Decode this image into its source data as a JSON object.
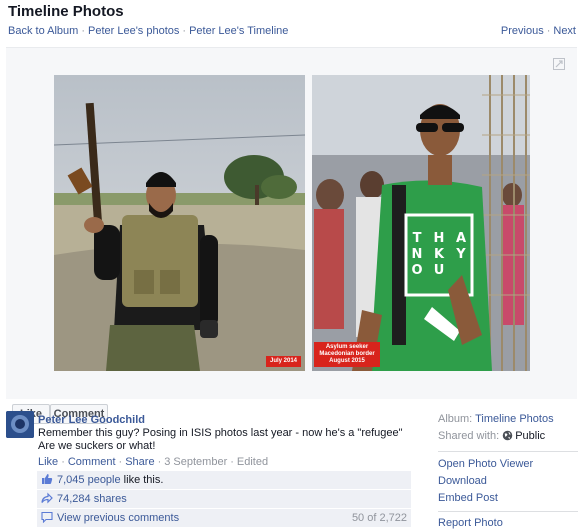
{
  "header": {
    "title": "Timeline Photos",
    "back_to_album": "Back to Album",
    "sep": "·",
    "photos_link": "Peter Lee's photos",
    "timeline_link": "Peter Lee's Timeline",
    "previous": "Previous",
    "next": "Next"
  },
  "photo": {
    "left_caption": "July 2014",
    "right_caption_line1": "Asylum seeker",
    "right_caption_line2": "Macedonian border",
    "right_caption_line3": "August 2015",
    "shirt_text": [
      "T",
      "H",
      "A",
      "N",
      "K",
      "Y",
      "O",
      "U"
    ]
  },
  "actions": {
    "like": "Like",
    "comment": "Comment"
  },
  "post": {
    "author": "Peter Lee Goodchild",
    "line1": "Remember this guy? Posing in ISIS photos last year - now he's a \"refugee\"",
    "line2": "Are we suckers or what!",
    "meta_like": "Like",
    "meta_comment": "Comment",
    "meta_share": "Share",
    "meta_date": "3 September",
    "meta_edited": "Edited"
  },
  "ufi": {
    "likes": "7,045 people",
    "likes_suffix": " like this.",
    "shares": "74,284 shares",
    "view_previous": "View previous comments",
    "comment_count": "50 of 2,722"
  },
  "sidebar": {
    "album_label": "Album:",
    "album_value": "Timeline Photos",
    "shared_label": "Shared with:",
    "shared_value": "Public",
    "open_viewer": "Open Photo Viewer",
    "download": "Download",
    "embed": "Embed Post",
    "report": "Report Photo"
  },
  "colors": {
    "link": "#3b5998",
    "caption_red": "#d8241c",
    "shirt_green": "#2e9e4a"
  }
}
